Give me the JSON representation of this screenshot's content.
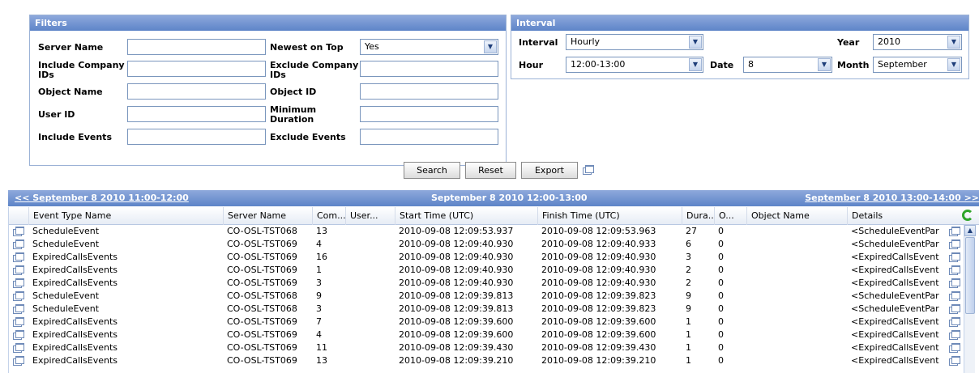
{
  "filters": {
    "title": "Filters",
    "server_name_label": "Server Name",
    "newest_on_top_label": "Newest on Top",
    "newest_on_top_value": "Yes",
    "include_company_ids_label": "Include Company IDs",
    "exclude_company_ids_label": "Exclude Company IDs",
    "object_name_label": "Object Name",
    "object_id_label": "Object ID",
    "user_id_label": "User ID",
    "minimum_duration_label": "Minimum Duration",
    "include_events_label": "Include Events",
    "exclude_events_label": "Exclude Events"
  },
  "interval": {
    "title": "Interval",
    "interval_label": "Interval",
    "interval_value": "Hourly",
    "year_label": "Year",
    "year_value": "2010",
    "hour_label": "Hour",
    "hour_value": "12:00-13:00",
    "date_label": "Date",
    "date_value": "8",
    "month_label": "Month",
    "month_value": "September"
  },
  "actions": {
    "search_label": "Search",
    "reset_label": "Reset",
    "export_label": "Export"
  },
  "nav": {
    "prev": "<< September 8 2010 11:00-12:00",
    "current": "September 8 2010 12:00-13:00",
    "next": "September 8 2010 13:00-14:00 >>"
  },
  "grid": {
    "columns": [
      "Event Type Name",
      "Server Name",
      "Com...",
      "User...",
      "Start Time (UTC)",
      "Finish Time (UTC)",
      "Dura...",
      "O...",
      "Object Name",
      "Details"
    ],
    "rows": [
      [
        "ScheduleEvent",
        "CO-OSL-TST068",
        "13",
        "",
        "2010-09-08 12:09:53.937",
        "2010-09-08 12:09:53.963",
        "27",
        "0",
        "",
        "<ScheduleEventPar"
      ],
      [
        "ScheduleEvent",
        "CO-OSL-TST069",
        "4",
        "",
        "2010-09-08 12:09:40.930",
        "2010-09-08 12:09:40.933",
        "6",
        "0",
        "",
        "<ScheduleEventPar"
      ],
      [
        "ExpiredCallsEvents",
        "CO-OSL-TST069",
        "16",
        "",
        "2010-09-08 12:09:40.930",
        "2010-09-08 12:09:40.930",
        "3",
        "0",
        "",
        "<ExpiredCallsEvent"
      ],
      [
        "ExpiredCallsEvents",
        "CO-OSL-TST069",
        "1",
        "",
        "2010-09-08 12:09:40.930",
        "2010-09-08 12:09:40.930",
        "2",
        "0",
        "",
        "<ExpiredCallsEvent"
      ],
      [
        "ExpiredCallsEvents",
        "CO-OSL-TST069",
        "3",
        "",
        "2010-09-08 12:09:40.930",
        "2010-09-08 12:09:40.930",
        "2",
        "0",
        "",
        "<ExpiredCallsEvent"
      ],
      [
        "ScheduleEvent",
        "CO-OSL-TST068",
        "9",
        "",
        "2010-09-08 12:09:39.813",
        "2010-09-08 12:09:39.823",
        "9",
        "0",
        "",
        "<ScheduleEventPar"
      ],
      [
        "ScheduleEvent",
        "CO-OSL-TST068",
        "3",
        "",
        "2010-09-08 12:09:39.813",
        "2010-09-08 12:09:39.823",
        "9",
        "0",
        "",
        "<ScheduleEventPar"
      ],
      [
        "ExpiredCallsEvents",
        "CO-OSL-TST069",
        "7",
        "",
        "2010-09-08 12:09:39.600",
        "2010-09-08 12:09:39.600",
        "1",
        "0",
        "",
        "<ExpiredCallsEvent"
      ],
      [
        "ExpiredCallsEvents",
        "CO-OSL-TST069",
        "4",
        "",
        "2010-09-08 12:09:39.600",
        "2010-09-08 12:09:39.600",
        "1",
        "0",
        "",
        "<ExpiredCallsEvent"
      ],
      [
        "ExpiredCallsEvents",
        "CO-OSL-TST069",
        "11",
        "",
        "2010-09-08 12:09:39.430",
        "2010-09-08 12:09:39.430",
        "1",
        "0",
        "",
        "<ExpiredCallsEvent"
      ],
      [
        "ExpiredCallsEvents",
        "CO-OSL-TST069",
        "13",
        "",
        "2010-09-08 12:09:39.210",
        "2010-09-08 12:09:39.210",
        "1",
        "0",
        "",
        "<ExpiredCallsEvent"
      ]
    ]
  }
}
